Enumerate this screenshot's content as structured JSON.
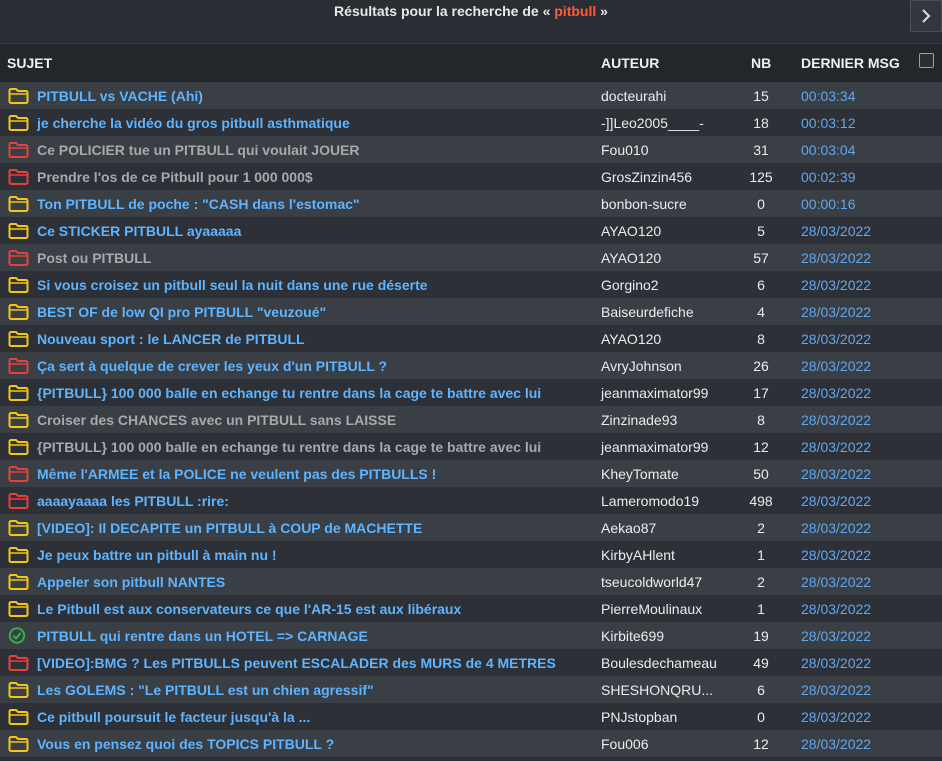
{
  "header": {
    "title_prefix": "Résultats pour la recherche de « ",
    "search_term": "pitbull",
    "title_suffix": " »",
    "next_icon": "chevron-right-icon"
  },
  "table": {
    "columns": {
      "subject": "SUJET",
      "author": "AUTEUR",
      "nb": "NB",
      "last": "DERNIER MSG"
    },
    "rows": [
      {
        "icon": "folder-yellow",
        "status": "normal",
        "subject": "PITBULL vs VACHE (Ahi)",
        "author": "docteurahi",
        "nb": "15",
        "last": "00:03:34"
      },
      {
        "icon": "folder-yellow",
        "status": "normal",
        "subject": "je cherche la vidéo du gros pitbull asthmatique",
        "author": "-]]Leo2005____-",
        "nb": "18",
        "last": "00:03:12"
      },
      {
        "icon": "folder-red",
        "status": "locked",
        "subject": "Ce POLICIER tue un PITBULL qui voulait JOUER",
        "author": "Fou010",
        "nb": "31",
        "last": "00:03:04"
      },
      {
        "icon": "folder-red",
        "status": "locked",
        "subject": "Prendre l'os de ce Pitbull pour 1 000 000$",
        "author": "GrosZinzin456",
        "nb": "125",
        "last": "00:02:39"
      },
      {
        "icon": "folder-yellow",
        "status": "normal",
        "subject": "Ton PITBULL de poche : \"CASH dans l'estomac\"",
        "author": "bonbon-sucre",
        "nb": "0",
        "last": "00:00:16"
      },
      {
        "icon": "folder-yellow",
        "status": "normal",
        "subject": "Ce STICKER PITBULL ayaaaaa",
        "author": "AYAO120",
        "nb": "5",
        "last": "28/03/2022"
      },
      {
        "icon": "folder-red",
        "status": "locked",
        "subject": "Post ou PITBULL",
        "author": "AYAO120",
        "nb": "57",
        "last": "28/03/2022"
      },
      {
        "icon": "folder-yellow",
        "status": "normal",
        "subject": "Si vous croisez un pitbull seul la nuit dans une rue déserte",
        "author": "Gorgino2",
        "nb": "6",
        "last": "28/03/2022"
      },
      {
        "icon": "folder-yellow",
        "status": "normal",
        "subject": "BEST OF de low QI pro PITBULL \"veuzoué\"",
        "author": "Baiseurdefiche",
        "nb": "4",
        "last": "28/03/2022"
      },
      {
        "icon": "folder-yellow",
        "status": "normal",
        "subject": "Nouveau sport : le LANCER de PITBULL",
        "author": "AYAO120",
        "nb": "8",
        "last": "28/03/2022"
      },
      {
        "icon": "folder-red",
        "status": "normal",
        "subject": "Ça sert à quelque de crever les yeux d'un PITBULL ?",
        "author": "AvryJohnson",
        "nb": "26",
        "last": "28/03/2022"
      },
      {
        "icon": "folder-yellow",
        "status": "normal",
        "subject": "{PITBULL} 100 000 balle en echange tu rentre dans la cage te battre avec lui",
        "author": "jeanmaximator99",
        "nb": "17",
        "last": "28/03/2022"
      },
      {
        "icon": "folder-yellow",
        "status": "locked",
        "subject": "Croiser des CHANCES avec un PITBULL sans LAISSE",
        "author": "Zinzinade93",
        "nb": "8",
        "last": "28/03/2022"
      },
      {
        "icon": "folder-yellow",
        "status": "locked",
        "subject": "{PITBULL} 100 000 balle en echange tu rentre dans la cage te battre avec lui",
        "author": "jeanmaximator99",
        "nb": "12",
        "last": "28/03/2022"
      },
      {
        "icon": "folder-red",
        "status": "normal",
        "subject": "Même l'ARMEE et la POLICE ne veulent pas des PITBULLS !",
        "author": "KheyTomate",
        "nb": "50",
        "last": "28/03/2022"
      },
      {
        "icon": "folder-red",
        "status": "normal",
        "subject": "aaaayaaaa les PITBULL :rire:",
        "author": "Lameromodo19",
        "nb": "498",
        "last": "28/03/2022"
      },
      {
        "icon": "folder-yellow",
        "status": "normal",
        "subject": "[VIDEO]: Il DECAPITE un PITBULL à COUP de MACHETTE",
        "author": "Aekao87",
        "nb": "2",
        "last": "28/03/2022"
      },
      {
        "icon": "folder-yellow",
        "status": "normal",
        "subject": "Je peux battre un pitbull à main nu !",
        "author": "KirbyAHlent",
        "nb": "1",
        "last": "28/03/2022"
      },
      {
        "icon": "folder-yellow",
        "status": "normal",
        "subject": "Appeler son pitbull NANTES",
        "author": "tseucoldworld47",
        "nb": "2",
        "last": "28/03/2022"
      },
      {
        "icon": "folder-yellow",
        "status": "normal",
        "subject": "Le Pitbull est aux conservateurs ce que l'AR-15 est aux libéraux",
        "author": "PierreMoulinaux",
        "nb": "1",
        "last": "28/03/2022"
      },
      {
        "icon": "check-green",
        "status": "normal",
        "subject": "PITBULL qui rentre dans un HOTEL => CARNAGE",
        "author": "Kirbite699",
        "nb": "19",
        "last": "28/03/2022"
      },
      {
        "icon": "folder-red",
        "status": "normal",
        "subject": "[VIDEO]:BMG ? Les PITBULLS peuvent ESCALADER des MURS de 4 METRES",
        "author": "Boulesdechameau",
        "nb": "49",
        "last": "28/03/2022"
      },
      {
        "icon": "folder-yellow",
        "status": "normal",
        "subject": "Les GOLEMS : \"Le PITBULL est un chien agressif\"",
        "author": "SHESHONQRU...",
        "nb": "6",
        "last": "28/03/2022"
      },
      {
        "icon": "folder-yellow",
        "status": "normal",
        "subject": "Ce pitbull poursuit le facteur jusqu'à la ...",
        "author": "PNJstopban",
        "nb": "0",
        "last": "28/03/2022"
      },
      {
        "icon": "folder-yellow",
        "status": "normal",
        "subject": "Vous en pensez quoi des TOPICS PITBULL ?",
        "author": "Fou006",
        "nb": "12",
        "last": "28/03/2022"
      }
    ]
  },
  "colors": {
    "link_blue": "#5fb4ff",
    "locked_gray": "#a8a9ab",
    "date_blue": "#5fa8f0",
    "search_term": "#ff5b3a",
    "folder_yellow": "#f5c518",
    "folder_red": "#e8413c",
    "check_green": "#2fb344"
  }
}
